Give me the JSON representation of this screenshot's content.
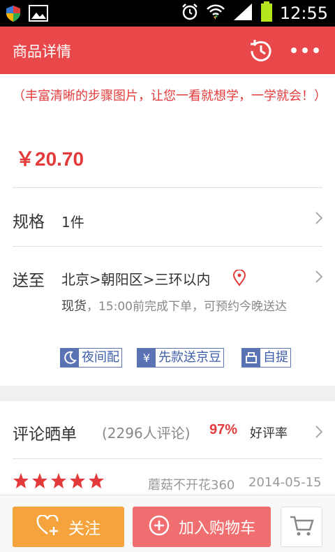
{
  "status_bar": {
    "time": "12:55",
    "icons": [
      "shield-app-icon",
      "image-icon",
      "alarm-icon",
      "wifi-icon",
      "signal-icon",
      "battery-icon"
    ]
  },
  "app_bar": {
    "title": "商品详情",
    "background": "#e8484a",
    "icons": [
      "history-icon",
      "more-icon"
    ]
  },
  "product": {
    "subtitle": "（丰富清晰的步骤图片，让您一看就想学，一学就会！）",
    "price": "￥20.70",
    "accent": "#e33b3b"
  },
  "spec": {
    "label": "规格",
    "value": "1件"
  },
  "shipping": {
    "label": "送至",
    "location": "北京>朝阳区>三环以内",
    "stock": "现货",
    "note": "，15:00前完成下单，可预约今晚送达",
    "tags": [
      {
        "icon": "moon-icon",
        "label": "夜间配"
      },
      {
        "icon": "yen-icon",
        "label": "先款送京豆"
      },
      {
        "icon": "pickup-icon",
        "label": "自提"
      }
    ]
  },
  "reviews": {
    "title": "评论晒单",
    "count": "(2296人评论)",
    "percent": "97%",
    "rate_label": "好评率",
    "latest": {
      "stars": 5,
      "user": "蘑菇不开花360",
      "date": "2014-05-15"
    }
  },
  "bottom_bar": {
    "follow_label": "关注",
    "add_to_cart_label": "加入购物车",
    "follow_color": "#f5a33c",
    "cart_color": "#f06e6f"
  }
}
